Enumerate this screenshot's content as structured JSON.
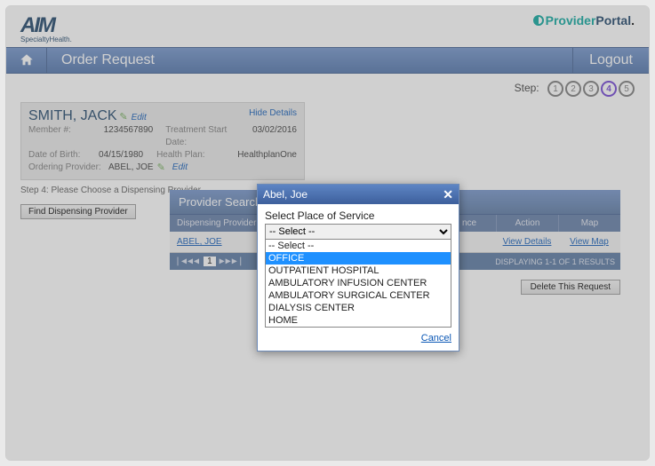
{
  "brand": {
    "name": "AIM",
    "sub": "SpecialtyHealth.",
    "portal_prefix": "Provider",
    "portal_suffix": "Portal"
  },
  "nav": {
    "title": "Order Request",
    "logout": "Logout"
  },
  "steps": {
    "label": "Step:",
    "items": [
      "1",
      "2",
      "3",
      "4",
      "5"
    ],
    "active_index": 3
  },
  "patient": {
    "name": "SMITH, JACK",
    "hide": "Hide Details",
    "edit": "Edit",
    "member_lbl": "Member #:",
    "member_val": "1234567890",
    "dob_lbl": "Date of Birth:",
    "dob_val": "04/15/1980",
    "op_lbl": "Ordering Provider:",
    "op_val": "ABEL, JOE",
    "tsd_lbl": "Treatment Start Date:",
    "tsd_val": "03/02/2016",
    "hp_lbl": "Health Plan:",
    "hp_val": "HealthplanOne"
  },
  "substep": "Step 4:  Please Choose a Dispensing Provider.",
  "buttons": {
    "find": "Find Dispensing Provider",
    "delete": "Delete This Request"
  },
  "search": {
    "title": "Provider Search",
    "cols": {
      "dp": "Dispensing Provider",
      "nce": "nce",
      "action": "Action",
      "map": "Map"
    },
    "row_name": "ABEL, JOE",
    "row_action": "View Details",
    "row_map": "View Map",
    "page_current": "1",
    "display": "DISPLAYING 1-1 OF 1 RESULTS"
  },
  "popup": {
    "title": "Abel, Joe",
    "prompt": "Select Place of Service",
    "selected": "-- Select --",
    "options": [
      "-- Select --",
      "OFFICE",
      "OUTPATIENT HOSPITAL",
      "AMBULATORY INFUSION CENTER",
      "AMBULATORY SURGICAL CENTER",
      "DIALYSIS CENTER",
      "HOME"
    ],
    "highlight_index": 1,
    "cancel": "Cancel"
  }
}
